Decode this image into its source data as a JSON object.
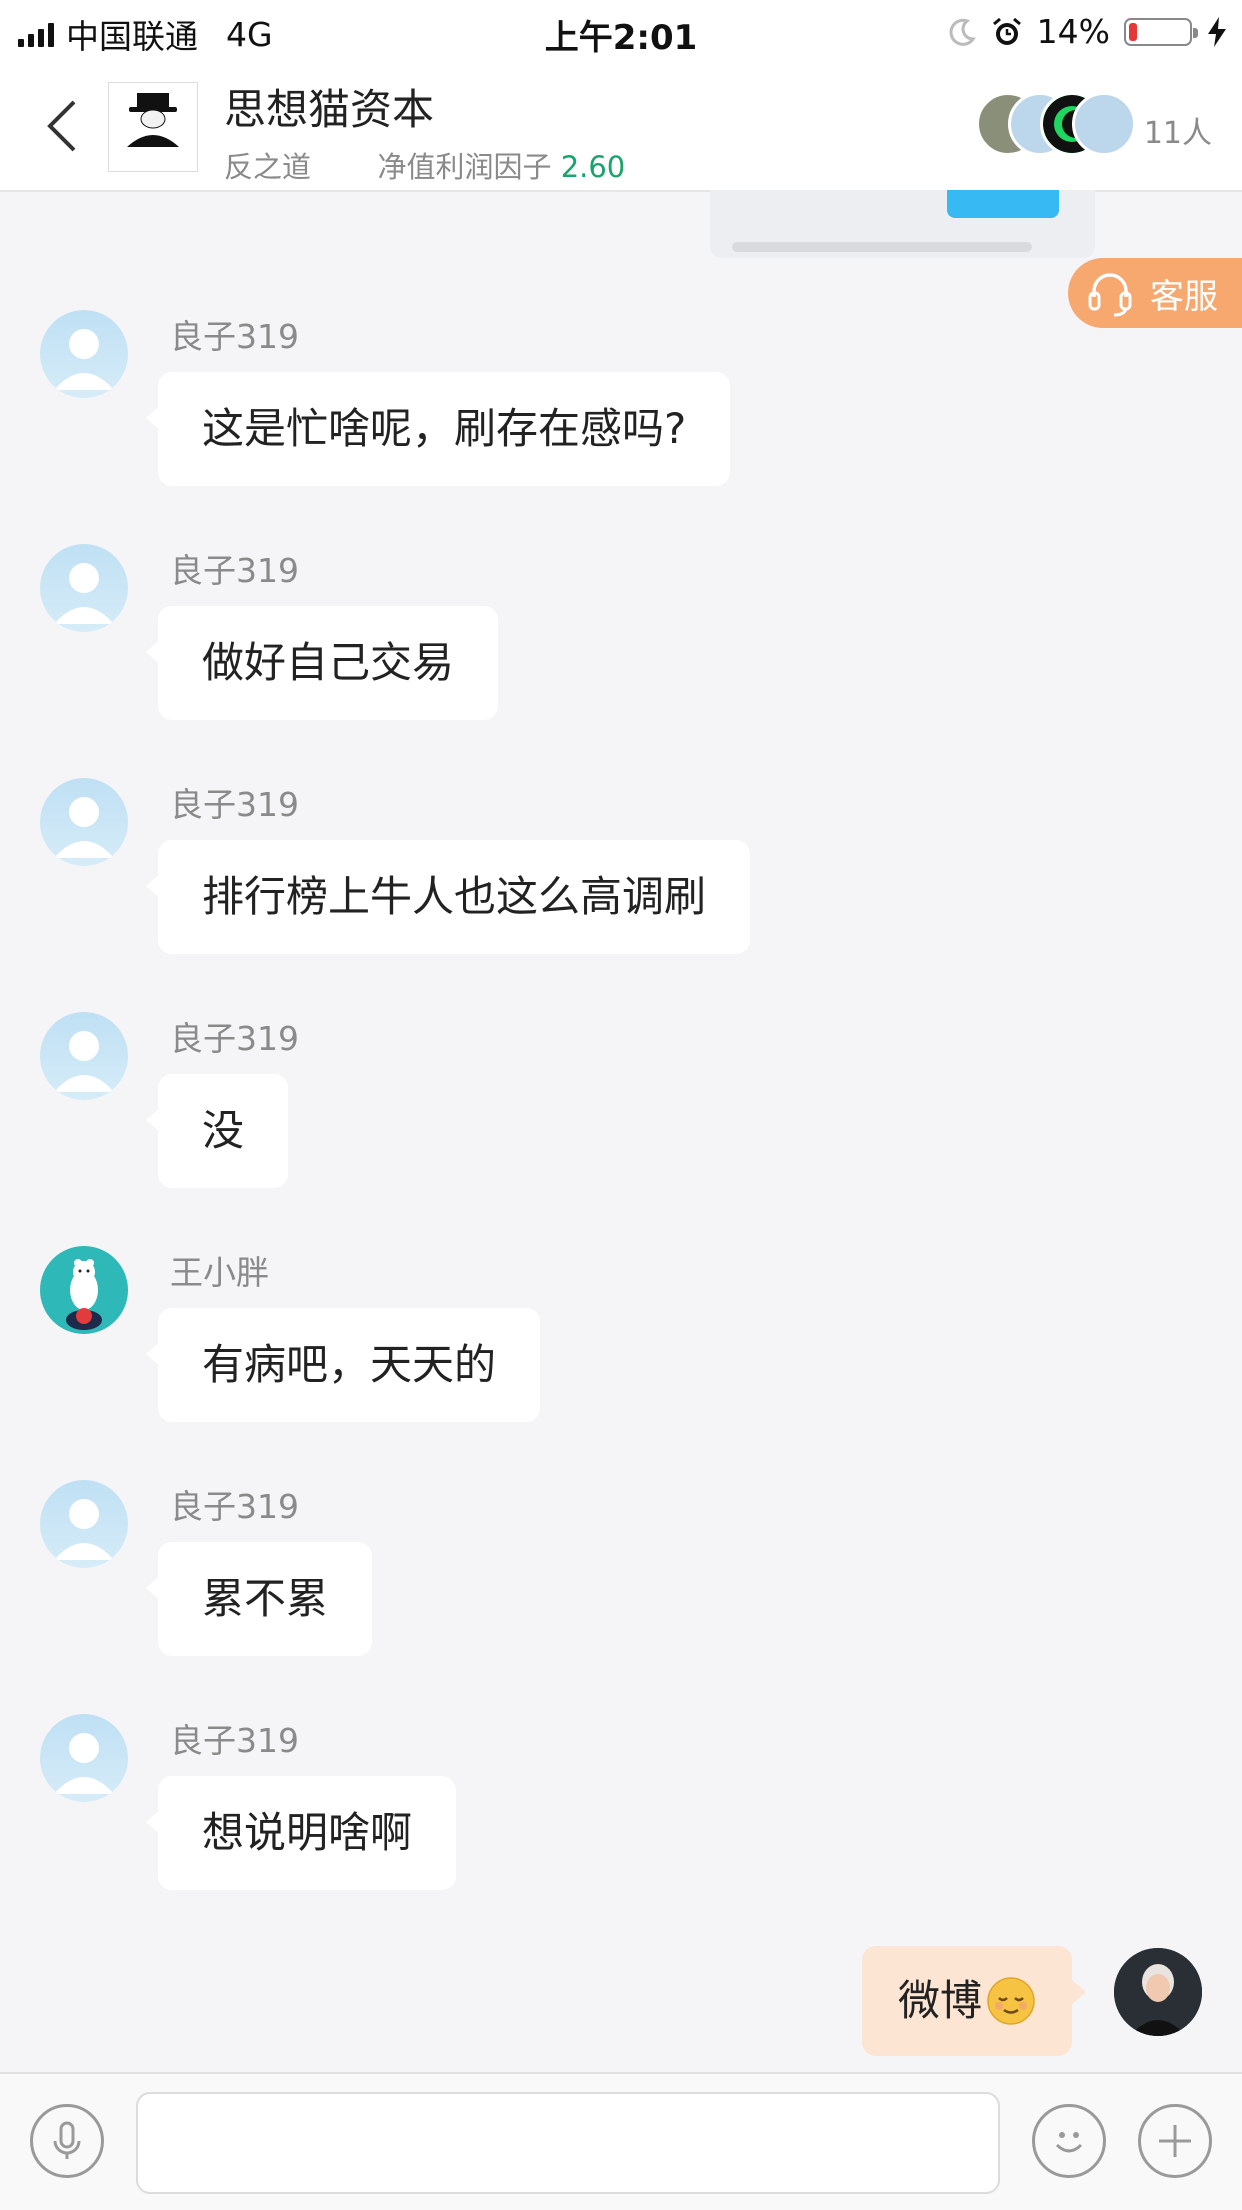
{
  "status_bar": {
    "carrier": "中国联通",
    "network": "4G",
    "time": "上午2:01",
    "battery_percent": "14%",
    "battery_level": 0.14,
    "icons": [
      "signal-bars-icon",
      "moon-icon",
      "alarm-icon",
      "battery-icon",
      "charging-icon"
    ]
  },
  "header": {
    "back_icon": "chevron-left-icon",
    "logo_text": "思想猫资本",
    "title": "思想猫资本",
    "subtitle_left": "反之道",
    "subtitle_label": "净值利润因子",
    "subtitle_value": "2.60",
    "member_count": "11人"
  },
  "customer_service": {
    "label": "客服",
    "icon": "headset-icon"
  },
  "messages": [
    {
      "sender": "良子319",
      "text": "这是忙啥呢，刷存在感吗?",
      "avatar": "default-avatar"
    },
    {
      "sender": "良子319",
      "text": "做好自己交易",
      "avatar": "default-avatar"
    },
    {
      "sender": "良子319",
      "text": "排行榜上牛人也这么高调刷",
      "avatar": "default-avatar"
    },
    {
      "sender": "良子319",
      "text": "没",
      "avatar": "default-avatar"
    },
    {
      "sender": "王小胖",
      "text": "有病吧，天天的",
      "avatar": "polar-bear-avatar"
    },
    {
      "sender": "良子319",
      "text": "累不累",
      "avatar": "default-avatar"
    },
    {
      "sender": "良子319",
      "text": "想说明啥啊",
      "avatar": "default-avatar"
    }
  ],
  "own_message": {
    "text": "微博",
    "emoji": "relieved-face-emoji"
  },
  "input_bar": {
    "placeholder": "",
    "icons": [
      "microphone-icon",
      "smiley-icon",
      "plus-icon"
    ]
  },
  "colors": {
    "accent_green": "#1aa36b",
    "service_orange": "#f7a86f",
    "own_bubble": "#fde5d3",
    "background": "#f5f5f7"
  }
}
